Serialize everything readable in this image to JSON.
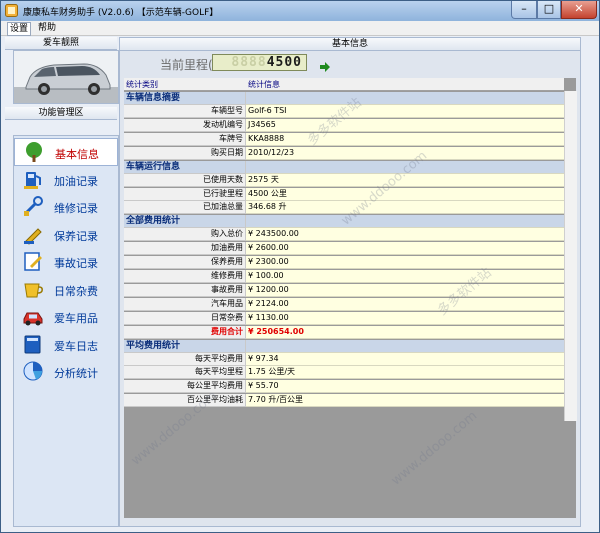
{
  "window": {
    "title": "康康私车财务助手 (V2.0.6) 【示范车辆-GOLF】",
    "controls": {
      "minimize": "–",
      "maximize": "□",
      "close": "✕"
    }
  },
  "menu": {
    "items": [
      "设置",
      "帮助"
    ]
  },
  "left": {
    "photo_header": "爱车靓照",
    "func_header": "功能管理区",
    "nav": [
      {
        "label": "基本信息",
        "icon": "tree-icon",
        "selected": true
      },
      {
        "label": "加油记录",
        "icon": "fuel-pump-icon",
        "selected": false
      },
      {
        "label": "维修记录",
        "icon": "wrench-icon",
        "selected": false
      },
      {
        "label": "保养记录",
        "icon": "pencil-icon",
        "selected": false
      },
      {
        "label": "事故记录",
        "icon": "edit-icon",
        "selected": false
      },
      {
        "label": "日常杂费",
        "icon": "cup-icon",
        "selected": false
      },
      {
        "label": "爱车用品",
        "icon": "car-icon",
        "selected": false
      },
      {
        "label": "爱车日志",
        "icon": "book-icon",
        "selected": false
      },
      {
        "label": "分析统计",
        "icon": "pie-chart-icon",
        "selected": false
      }
    ]
  },
  "main": {
    "header": "基本信息",
    "odometer": {
      "label": "当前里程(KM)",
      "value": "4500",
      "ghost": "8888"
    },
    "columns": [
      "统计类别",
      "统计信息"
    ],
    "sections": [
      {
        "title": "车辆信息摘要",
        "rows": [
          {
            "k": "车辆型号",
            "v": "Golf-6 TSI"
          },
          {
            "k": "发动机编号",
            "v": "J34565"
          },
          {
            "k": "车牌号",
            "v": "KKA8888"
          },
          {
            "k": "购买日期",
            "v": "2010/12/23"
          }
        ]
      },
      {
        "title": "车辆运行信息",
        "rows": [
          {
            "k": "已使用天数",
            "v": "2575 天"
          },
          {
            "k": "已行驶里程",
            "v": "4500 公里"
          },
          {
            "k": "已加油总量",
            "v": "346.68 升"
          }
        ]
      },
      {
        "title": "全部费用统计",
        "rows": [
          {
            "k": "购入总价",
            "v": "¥ 243500.00"
          },
          {
            "k": "加油费用",
            "v": "¥ 2600.00"
          },
          {
            "k": "保养费用",
            "v": "¥ 2300.00"
          },
          {
            "k": "维修费用",
            "v": "¥ 100.00"
          },
          {
            "k": "事故费用",
            "v": "¥ 1200.00"
          },
          {
            "k": "汽车用品",
            "v": "¥ 2124.00"
          },
          {
            "k": "日常杂费",
            "v": "¥ 1130.00"
          },
          {
            "k": "费用合计",
            "v": "¥ 250654.00",
            "total": true
          }
        ]
      },
      {
        "title": "平均费用统计",
        "rows": [
          {
            "k": "每天平均费用",
            "v": "¥ 97.34"
          },
          {
            "k": "每天平均里程",
            "v": "1.75 公里/天"
          },
          {
            "k": "每公里平均费用",
            "v": "¥ 55.70"
          },
          {
            "k": "百公里平均油耗",
            "v": "7.70 升/百公里"
          }
        ]
      }
    ]
  },
  "watermark": [
    "多多软件站",
    "www.ddooo.com"
  ]
}
